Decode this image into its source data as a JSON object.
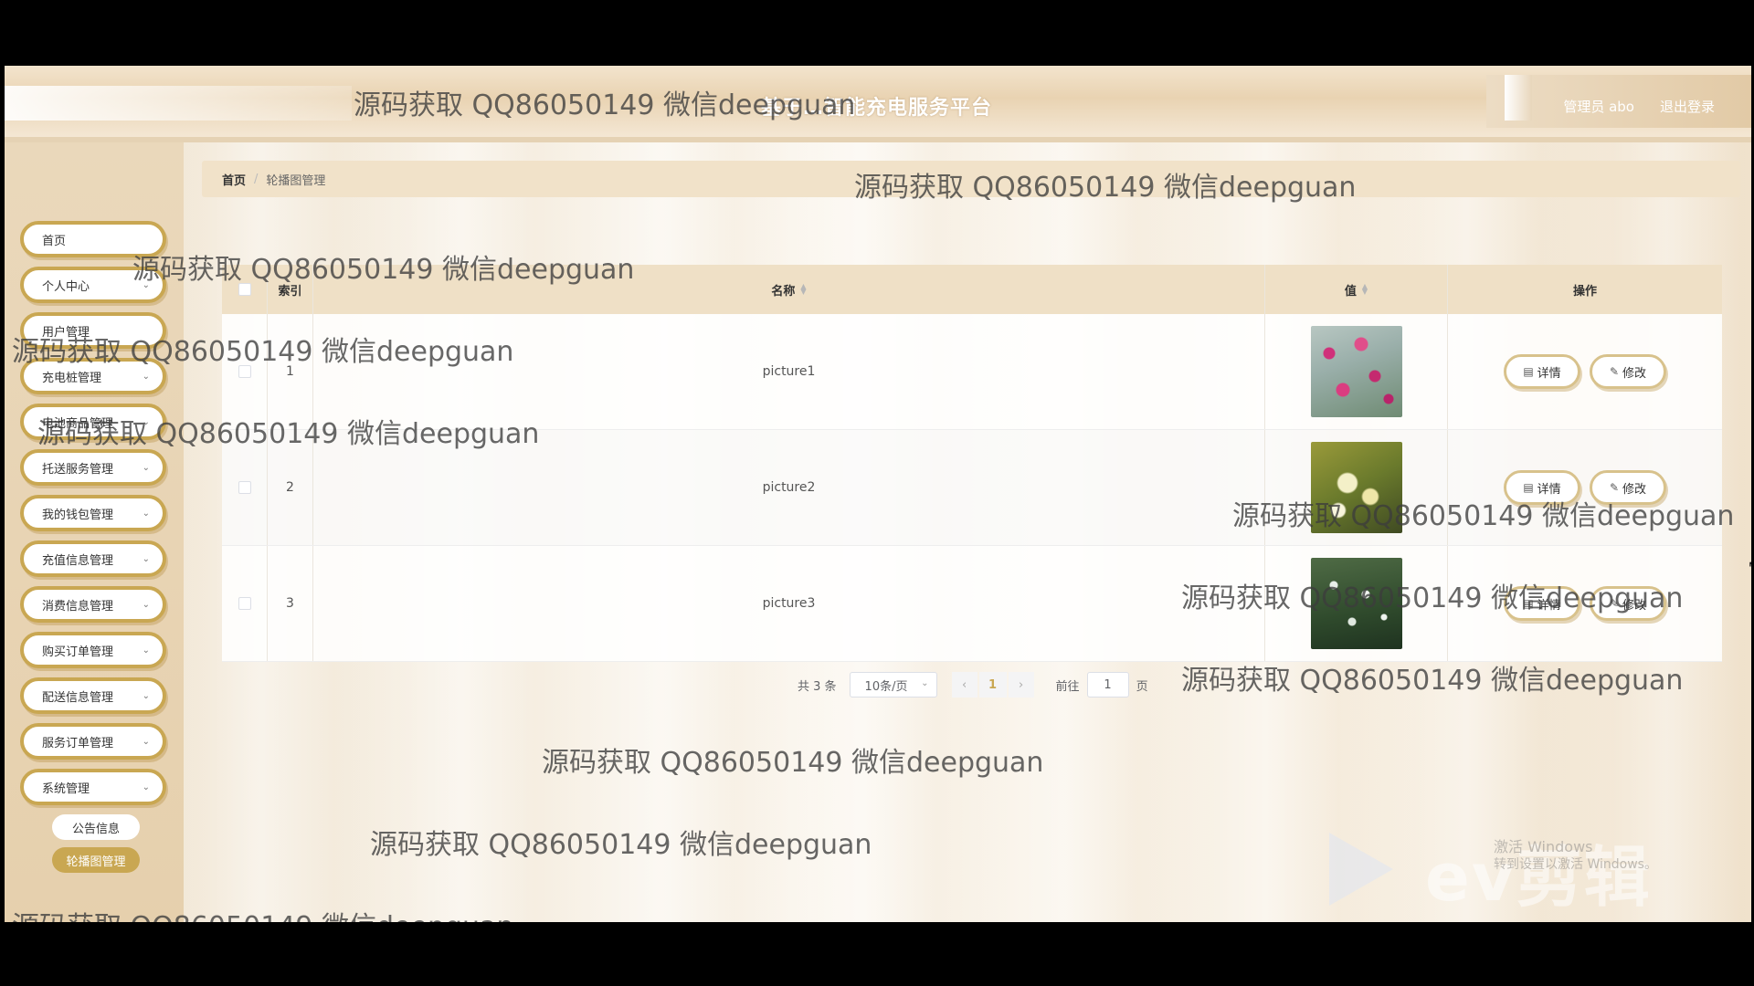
{
  "header": {
    "title": "基于…智能充电服务平台",
    "admin_label": "管理员 abo",
    "logout": "退出登录"
  },
  "sidebar": {
    "items": [
      {
        "label": "首页",
        "has_children": false
      },
      {
        "label": "个人中心",
        "has_children": true
      },
      {
        "label": "用户管理",
        "has_children": false
      },
      {
        "label": "充电桩管理",
        "has_children": true
      },
      {
        "label": "电池商品管理",
        "has_children": true
      },
      {
        "label": "托送服务管理",
        "has_children": true
      },
      {
        "label": "我的钱包管理",
        "has_children": true
      },
      {
        "label": "充值信息管理",
        "has_children": true
      },
      {
        "label": "消费信息管理",
        "has_children": true
      },
      {
        "label": "购买订单管理",
        "has_children": true
      },
      {
        "label": "配送信息管理",
        "has_children": true
      },
      {
        "label": "服务订单管理",
        "has_children": true
      },
      {
        "label": "系统管理",
        "has_children": true
      }
    ],
    "sub_items": [
      {
        "label": "公告信息",
        "active": false
      },
      {
        "label": "轮播图管理",
        "active": true
      }
    ]
  },
  "breadcrumb": {
    "home": "首页",
    "separator": "/",
    "current": "轮播图管理"
  },
  "table": {
    "columns": [
      "索引",
      "名称",
      "值",
      "操作"
    ],
    "rows": [
      {
        "index": "1",
        "name": "picture1",
        "image": "pink-flowers"
      },
      {
        "index": "2",
        "name": "picture2",
        "image": "white-daisies"
      },
      {
        "index": "3",
        "name": "picture3",
        "image": "green-meadow"
      }
    ],
    "detail_label": "详情",
    "edit_label": "修改"
  },
  "pagination": {
    "total": "共 3 条",
    "page_size": "10条/页",
    "current_page": "1",
    "jump_label": "前往",
    "jump_value": "1",
    "jump_unit": "页"
  },
  "watermark": {
    "text": "源码获取 QQ86050149 微信deepguan"
  },
  "overlay": {
    "activation_line1": "激活 Windows",
    "activation_line2": "转到设置以激活 Windows。",
    "logo_text": "ev剪辑"
  },
  "colors": {
    "accent": "#c9a752",
    "header_bg": "#e9d3b2",
    "breadcrumb_bg": "#f1e2c9"
  }
}
